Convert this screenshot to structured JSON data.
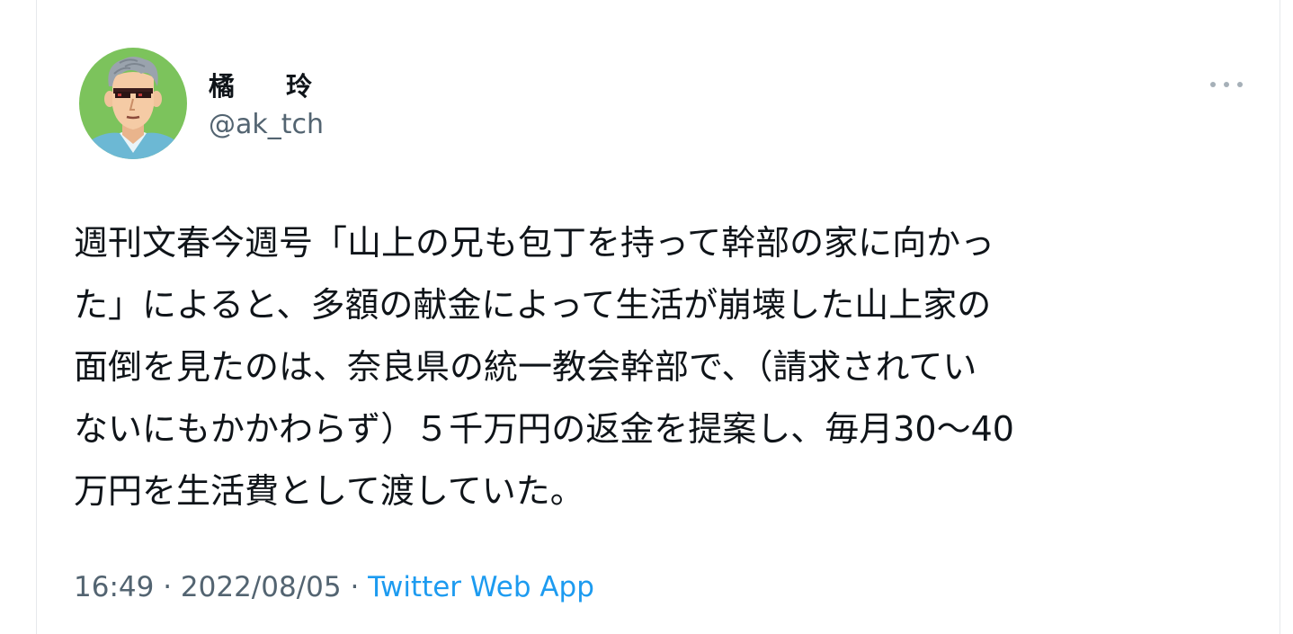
{
  "user": {
    "display_name": "橘　玲",
    "handle": "@ak_tch",
    "avatar_icon": "cartoon-man-with-sunglasses-avatar"
  },
  "more_menu_icon": "more-horizontal-icon",
  "tweet": {
    "lines": [
      "週刊文春今週号「山上の兄も包丁を持って幹部の家に向かっ",
      "た」によると、多額の献金によって生活が崩壊した山上家の",
      "面倒を見たのは、奈良県の統一教会幹部で、（請求されてい",
      "ないにもかかわらず）５千万円の返金を提案し、毎月30〜40",
      "万円を生活費として渡していた。"
    ]
  },
  "meta": {
    "time": "16:49",
    "sep1": " · ",
    "date": "2022/08/05",
    "sep2": " · ",
    "source": "Twitter Web App"
  },
  "colors": {
    "text": "#0f1419",
    "secondary": "#536471",
    "link": "#1d9bf0",
    "avatar_bg": "#7cc35c"
  }
}
